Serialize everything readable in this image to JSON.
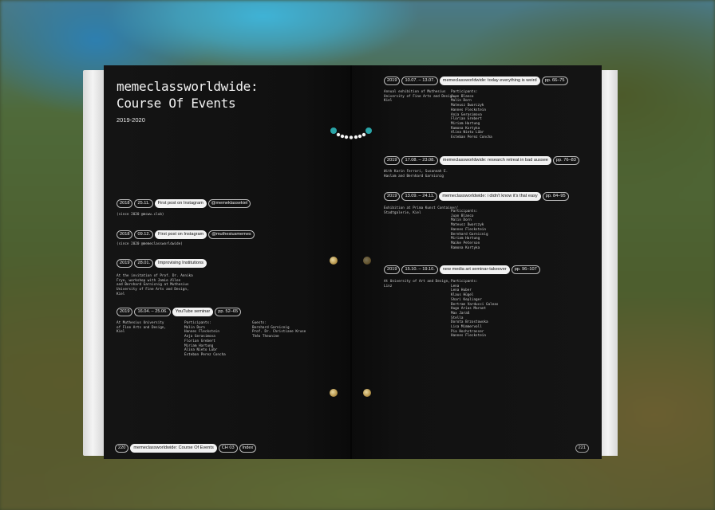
{
  "left": {
    "title": "memeclassworldwide:\nCourse Of Events",
    "years": "2019-2020",
    "events": [
      {
        "pills": [
          "2018",
          "25.11.",
          "First post on Instagram",
          "@memeklassekiel"
        ],
        "desc": "(since 2020 @mcww.club)"
      },
      {
        "pills": [
          "2018",
          "09.12.",
          "First post on Instagram",
          "@muthesiusmemes"
        ],
        "desc": "(since 2020 @memeclassworldwide)"
      },
      {
        "pills": [
          "2019",
          "28.01.",
          "Improvising Institutions"
        ],
        "desc": "At the invitation of Prof. Dr. Annika\nFrye, workshop with Jamie Allen\nand Bernhard Garnicnig at Muthesius\nUniversity of Fine Arts and Design,\nKiel"
      },
      {
        "pills": [
          "2019",
          "16.04. – 25.06.",
          "YouTube seminar",
          "pp. 52–65"
        ],
        "desc": "At Muthesius University\nof Fine Arts and Design,\nKiel",
        "desc2": "Participants:\nMalin Dorn\nHannes Fleckstein\nAnja Gerasimova\nFlorian Grebert\nMiriam Hartung\nAlina Nieto Lübr\nEsteban Perez Concha",
        "desc3": "Guests:\nBernhard Garnicnig\nProf. Dr. Christiane Kruse\nThéo Theunine"
      }
    ],
    "footer": {
      "page": "220",
      "section": "memeclassworldwide: Course Of Events",
      "chapter": "CH 03",
      "index": "Index"
    }
  },
  "right": {
    "events": [
      {
        "pills": [
          "2019",
          "10.07. – 13.07.",
          "memeclassworldwide: today everything is weird",
          "pp. 66–75"
        ],
        "desc": "Annual exhibition of Muthesius\nUniversity of Fine Arts and Design,\nKiel",
        "desc2": "Participants:\nJuan Blanco\nMalin Dorn\nMateusz Dworczyk\nHannes Fleckstein\nAnja Gerasimova\nFlorian Grebert\nMiriam Hartung\nRamona Kortyka\nAlina Nieto Lübr\nEsteban Perez Concha"
      },
      {
        "pills": [
          "2019",
          "17.08. – 23.08.",
          "memeclassworldwide: research retreat in bad aussee",
          "pp. 76–83"
        ],
        "desc": "With Karin Ferrari, Susannah E.\nHaslam and Bernhard Garnicnig"
      },
      {
        "pills": [
          "2019",
          "13.09. – 24.11.",
          "memeclassworldwide: i didn't know it's that easy",
          "pp. 84–95"
        ],
        "desc": "Exhibition at Prima Kunst Container/\nStadtgalerie, Kiel",
        "desc2": "Participants:\nJuan Blanco\nMalin Dorn\nMateusz Dworczyk\nHannes Fleckstein\nBernhard Garnicnig\nMiriam Hartung\nMaike Peterson\nRamona Kortyka"
      },
      {
        "pills": [
          "2019",
          "15.10. – 19.10.",
          "new media art seminar-takeover",
          "pp. 96–107"
        ],
        "desc": "At University of Art and Design,\nLinz",
        "desc2": "Participants:\nLena\nLena Huber\nKlaus Hügel\nShari Keplinger\nBertram Varducci Galeas\nHugo Arias Marant\nMax Jaraß\nStella\nDorota Brzostowska\nLisa Mimmervoll\nPia Hochstrasser\nHannes Fleckstein"
      }
    ],
    "page": "221"
  },
  "colors": {
    "page": "#111111",
    "text": "#f2f2f2",
    "pill_fill": "#f2f2f2"
  }
}
